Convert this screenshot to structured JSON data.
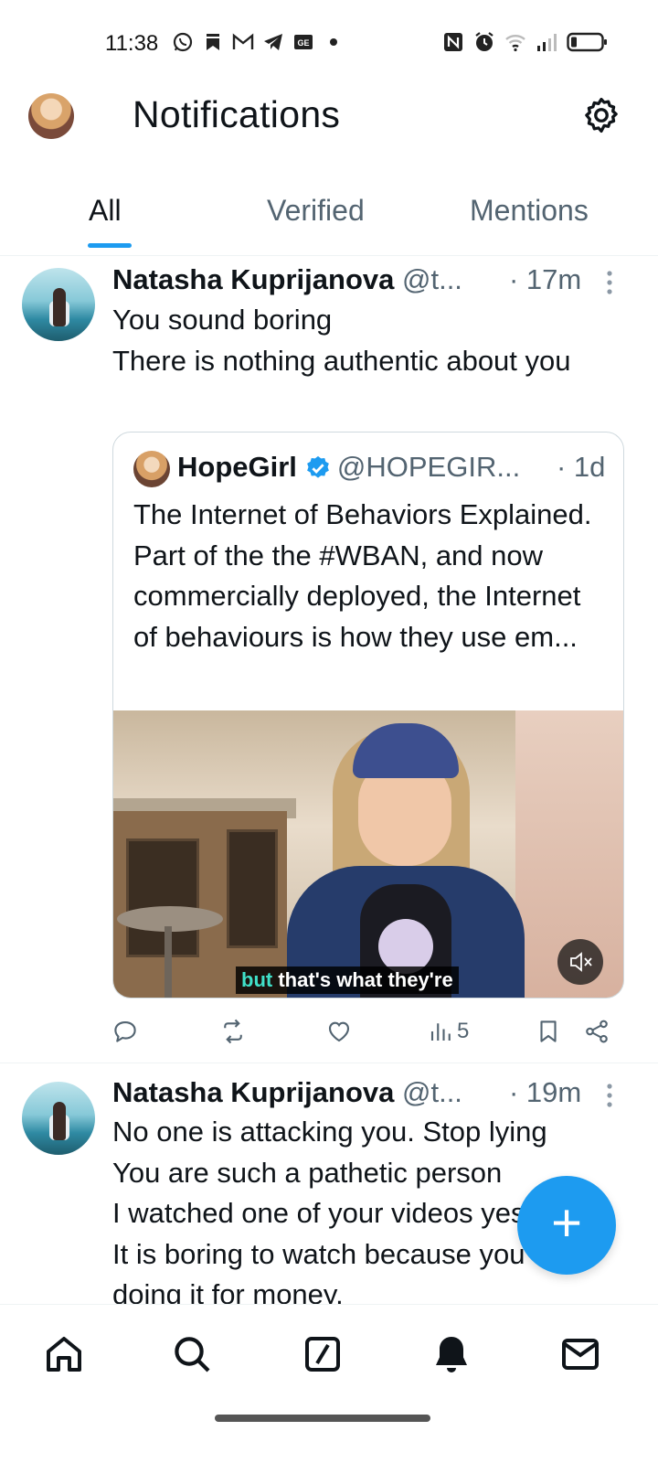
{
  "status_bar": {
    "time": "11:38",
    "left_icons": [
      "whatsapp-icon",
      "bookmark-icon",
      "gmail-icon",
      "telegram-icon",
      "ge-icon",
      "dot-icon"
    ],
    "right_icons": [
      "nfc-icon",
      "alarm-icon",
      "wifi-icon",
      "signal-icon",
      "battery-icon"
    ]
  },
  "header": {
    "title": "Notifications"
  },
  "tabs": [
    {
      "label": "All",
      "active": true
    },
    {
      "label": "Verified",
      "active": false
    },
    {
      "label": "Mentions",
      "active": false
    }
  ],
  "tweets": [
    {
      "name": "Natasha Kuprijanova",
      "handle": "@t...",
      "time": "· 17m",
      "text": "You sound boring\nThere is nothing authentic about you",
      "quote": {
        "name": "HopeGirl",
        "handle": "@HOPEGIR...",
        "time": "· 1d",
        "text": "The Internet of Behaviors Explained. Part of the the #WBAN, and now commercially deployed, the Internet of behaviours is how they use em...",
        "caption_highlight": "but",
        "caption_rest": " that's what they're"
      },
      "actions": {
        "views_count": "5"
      }
    },
    {
      "name": "Natasha Kuprijanova",
      "handle": "@t...",
      "time": "· 19m",
      "text": "No one is attacking you. Stop lying\nYou are such a pathetic person\nI watched one of your videos yesterday. It is boring to watch because you are doing it for money."
    }
  ],
  "fab": {
    "label": "+"
  },
  "colors": {
    "accent": "#1d9bf0",
    "text_primary": "#0f1419",
    "text_secondary": "#536471"
  }
}
